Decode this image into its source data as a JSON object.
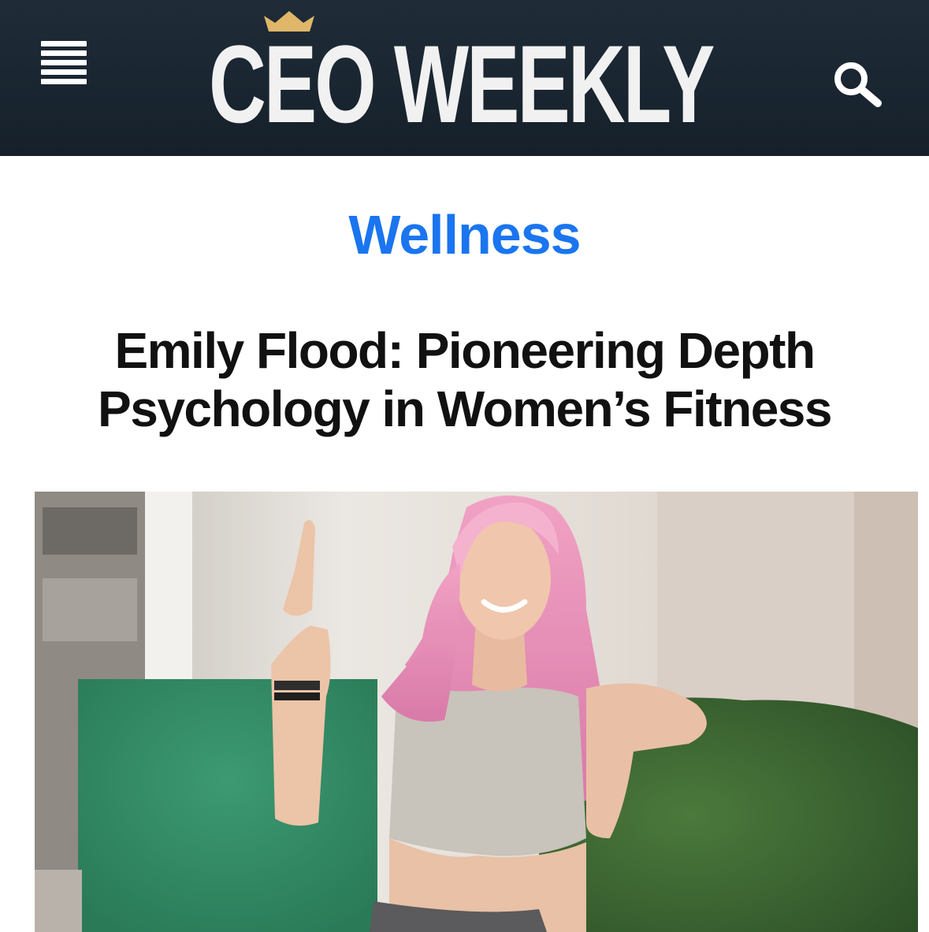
{
  "header": {
    "logo_text": "CEO WEEKLY",
    "menu_icon": "hamburger-menu-icon",
    "search_icon": "search-icon",
    "background_color": "#1b2733",
    "logo_color": "#f1f1f1",
    "crown_color": "#e0b769"
  },
  "article": {
    "category": "Wellness",
    "category_color": "#1a75ef",
    "title": "Emily Flood: Pioneering Depth Psychology in Women’s Fitness"
  },
  "hero_image": {
    "subject": "woman-with-pink-hair-pointing-up-photo"
  }
}
